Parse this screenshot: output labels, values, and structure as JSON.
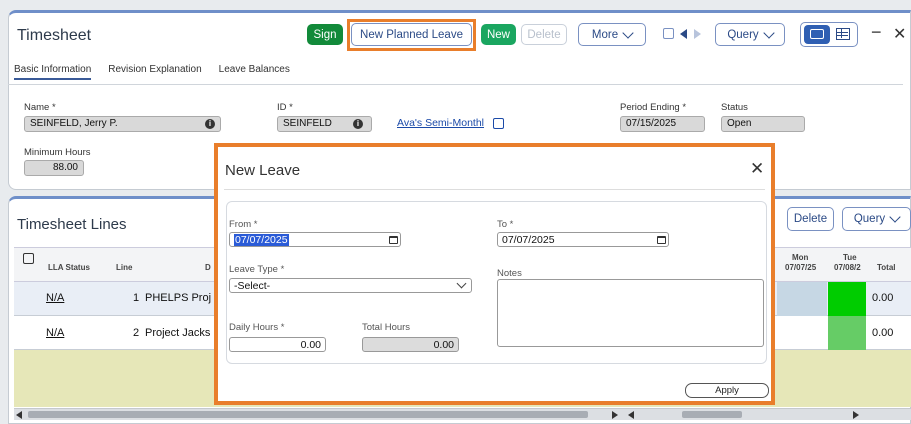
{
  "header": {
    "title": "Timesheet",
    "sign": "Sign",
    "new_planned_leave": "New Planned Leave",
    "new": "New",
    "delete": "Delete",
    "more": "More",
    "query": "Query",
    "minimize": "−",
    "close": "✕"
  },
  "tabs": [
    "Basic Information",
    "Revision Explanation",
    "Leave Balances"
  ],
  "basic": {
    "name_label": "Name *",
    "name_value": "SEINFELD, Jerry P.",
    "id_label": "ID *",
    "id_value": "SEINFELD",
    "schedule_link": "Ava's Semi-Monthl",
    "period_ending_label": "Period Ending *",
    "period_ending_value": "07/15/2025",
    "status_label": "Status",
    "status_value": "Open",
    "min_hours_label": "Minimum Hours",
    "min_hours_value": "88.00"
  },
  "lines": {
    "title": "Timesheet Lines",
    "delete": "Delete",
    "query": "Query",
    "columns": {
      "lla_status": "LLA Status",
      "line": "Line",
      "desc": "D",
      "mon": "Mon",
      "mon_date": "07/07/25",
      "tue": "Tue",
      "tue_date": "07/08/2",
      "total": "Total"
    },
    "rows": [
      {
        "status": "N/A",
        "line": "1",
        "desc": "PHELPS Proj",
        "total": "0.00"
      },
      {
        "status": "N/A",
        "line": "2",
        "desc": "Project Jacks",
        "total": "0.00"
      }
    ]
  },
  "modal": {
    "title": "New Leave",
    "close": "✕",
    "from_label": "From *",
    "from_value": "07/07/2025",
    "to_label": "To *",
    "to_value": "07/07/2025",
    "leave_type_label": "Leave Type *",
    "leave_type_value": "-Select-",
    "notes_label": "Notes",
    "daily_hours_label": "Daily Hours *",
    "daily_hours_value": "0.00",
    "total_hours_label": "Total Hours",
    "total_hours_value": "0.00",
    "apply": "Apply"
  },
  "colors": {
    "accent": "#e97e2b",
    "sign_green": "#128a3a",
    "new_green": "#1aa660",
    "cell_green": "#00cc00",
    "cell_light_green": "#66cc66"
  }
}
